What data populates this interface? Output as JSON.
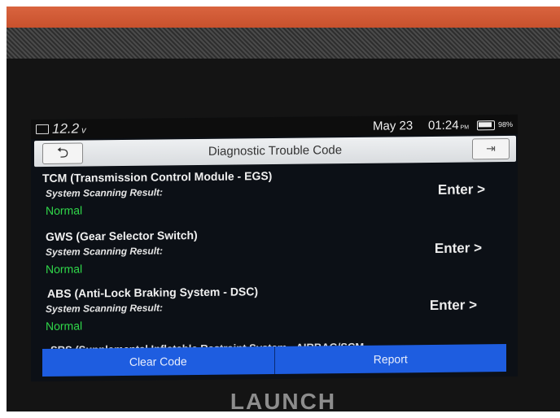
{
  "status_bar": {
    "voltage": "12.2",
    "voltage_unit": "v",
    "date": "May 23",
    "time": "01:24",
    "ampm": "PM",
    "battery_pct": "98%"
  },
  "header": {
    "title": "Diagnostic Trouble Code"
  },
  "systems": [
    {
      "name": "TCM (Transmission Control Module - EGS)",
      "label": "System Scanning Result:",
      "status": "Normal",
      "action": "Enter >"
    },
    {
      "name": "GWS (Gear Selector Switch)",
      "label": "System Scanning Result:",
      "status": "Normal",
      "action": "Enter >"
    },
    {
      "name": "ABS (Anti-Lock Braking System - DSC)",
      "label": "System Scanning Result:",
      "status": "Normal",
      "action": "Enter >"
    }
  ],
  "partial_item": "SRS (Supplemental Inflatable Restraint System - AIRBAG/SCM",
  "footer": {
    "clear_code": "Clear Code",
    "report": "Report"
  },
  "brand": "LAUNCH",
  "colors": {
    "status_ok": "#30d84a",
    "button_blue": "#1e5de0",
    "case_orange": "#c8512d"
  }
}
